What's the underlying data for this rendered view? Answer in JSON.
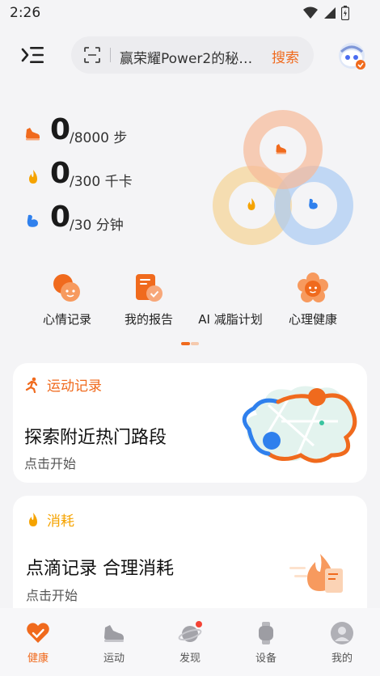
{
  "status": {
    "time": "2:26"
  },
  "search": {
    "text": "赢荣耀Power2的秘…",
    "button": "搜索"
  },
  "stats": [
    {
      "value": "0",
      "goal": "/8000 步",
      "icon": "shoe-icon"
    },
    {
      "value": "0",
      "goal": "/300 千卡",
      "icon": "flame-icon"
    },
    {
      "value": "0",
      "goal": "/30 分钟",
      "icon": "arm-icon"
    }
  ],
  "shortcuts": [
    {
      "label": "心情记录",
      "icon": "mood-icon"
    },
    {
      "label": "我的报告",
      "icon": "report-icon"
    },
    {
      "label": "AI 减脂计划",
      "icon": "ai-plan-icon"
    },
    {
      "label": "心理健康",
      "icon": "flower-icon"
    }
  ],
  "cards": {
    "exercise": {
      "header": "运动记录",
      "title": "探索附近热门路段",
      "subtitle": "点击开始"
    },
    "consumption": {
      "header": "消耗",
      "title": "点滴记录 合理消耗",
      "subtitle": "点击开始"
    }
  },
  "nav": [
    {
      "label": "健康",
      "icon": "heart-icon",
      "active": true
    },
    {
      "label": "运动",
      "icon": "sneaker-icon"
    },
    {
      "label": "发现",
      "icon": "planet-icon"
    },
    {
      "label": "设备",
      "icon": "watch-icon"
    },
    {
      "label": "我的",
      "icon": "profile-icon"
    }
  ],
  "colors": {
    "accent": "#f06a1d",
    "ring_steps": "#f7b999",
    "ring_calories": "#f6d59a",
    "ring_minutes": "#a9cbf3"
  }
}
